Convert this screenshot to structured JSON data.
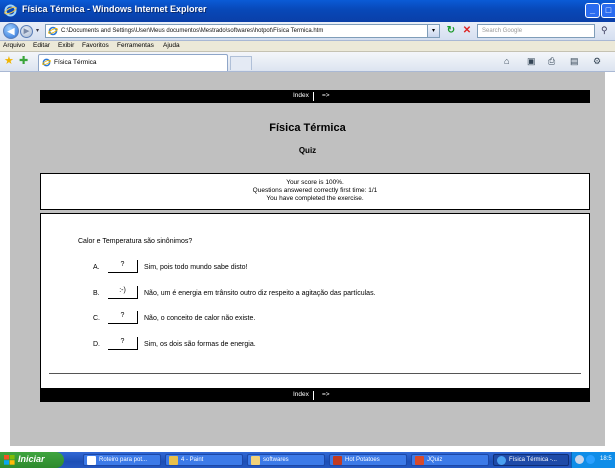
{
  "window": {
    "title": "Física Térmica - Windows Internet Explorer",
    "min_label": "_",
    "max_label": "□"
  },
  "toolbar": {
    "back_label": "◀",
    "forward_label": "▶",
    "nav_dropdown": "▾",
    "address": "C:\\Documents and Settings\\User\\Meus documentos\\Mestrado\\softwares\\hotpot\\Física Termica.htm",
    "address_dropdown": "▾",
    "refresh_label": "↻",
    "stop_label": "✕",
    "search_placeholder": "Search Google",
    "search_icon_label": "⚲"
  },
  "menu": [
    "Arquivo",
    "Editar",
    "Exibir",
    "Favoritos",
    "Ferramentas",
    "Ajuda"
  ],
  "favorites": {
    "star_label": "★",
    "add_label": "✚"
  },
  "tab": {
    "label": "Física Térmica"
  },
  "commands": {
    "home_label": "⌂",
    "feeds_label": "▣",
    "print_label": "⎙",
    "page_label": "▤",
    "tools_label": "⚙"
  },
  "page": {
    "nav_index": "Index",
    "nav_next": "=>",
    "title": "Física Térmica",
    "subtitle": "Quiz",
    "feedback": [
      "Your score is 100%.",
      "Questions answered correctly first time: 1/1",
      "You have completed the exercise."
    ],
    "question": "Calor e Temperatura são sinônimos?",
    "answers": [
      {
        "letter": "A.",
        "button": "?",
        "text": "Sim, pois todo mundo sabe disto!"
      },
      {
        "letter": "B.",
        "button": ":-)",
        "text": "Não, um é energia em trânsito outro diz respeito a agitação das partículas."
      },
      {
        "letter": "C.",
        "button": "?",
        "text": "Não, o conceito de calor não existe."
      },
      {
        "letter": "D.",
        "button": "?",
        "text": "Sim, os dois são formas de energia."
      }
    ]
  },
  "taskbar": {
    "start_label": "Iniciar",
    "tasks": [
      {
        "label": "Roteiro para pot...",
        "color": "#ffffff"
      },
      {
        "label": "4 - Paint",
        "color": "#e8c04a"
      },
      {
        "label": "softwares",
        "color": "#f2d27a"
      },
      {
        "label": "Hot Potatoes",
        "color": "#c23b22"
      },
      {
        "label": "JQuiz",
        "color": "#d84a2a"
      },
      {
        "label": "Física Térmica -...",
        "color": "#4aa0f0"
      }
    ],
    "clock": "18:5"
  }
}
